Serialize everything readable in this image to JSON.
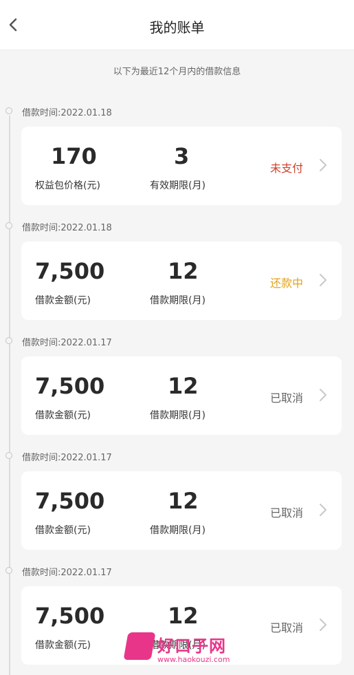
{
  "header": {
    "title": "我的账单",
    "back_icon": "chevron-left-icon"
  },
  "subtitle": "以下为最近12个月内的借款信息",
  "colors": {
    "unpaid": "#d0412b",
    "repaying": "#e3a21a",
    "cancelled": "#666666"
  },
  "records": [
    {
      "date": "借款时间:2022.01.18",
      "value1": "170",
      "label1": "权益包价格(元)",
      "value2": "3",
      "label2": "有效期限(月)",
      "status": "未支付"
    },
    {
      "date": "借款时间:2022.01.18",
      "value1": "7,500",
      "label1": "借款金额(元)",
      "value2": "12",
      "label2": "借款期限(月)",
      "status": "还款中"
    },
    {
      "date": "借款时间:2022.01.17",
      "value1": "7,500",
      "label1": "借款金额(元)",
      "value2": "12",
      "label2": "借款期限(月)",
      "status": "已取消"
    },
    {
      "date": "借款时间:2022.01.17",
      "value1": "7,500",
      "label1": "借款金额(元)",
      "value2": "12",
      "label2": "借款期限(月)",
      "status": "已取消"
    },
    {
      "date": "借款时间:2022.01.17",
      "value1": "7,500",
      "label1": "借款金额(元)",
      "value2": "12",
      "label2": "借款期限(月)",
      "status": "已取消"
    }
  ],
  "watermark": {
    "title": "好口子网",
    "url": "www.haokouzi.com"
  }
}
